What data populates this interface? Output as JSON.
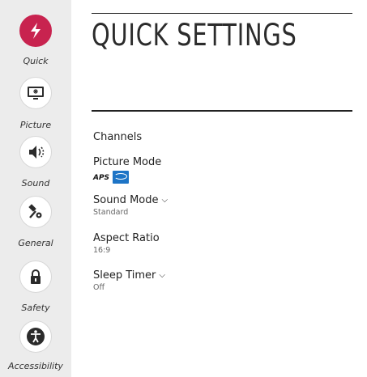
{
  "sidebar": {
    "items": [
      {
        "label": "Quick",
        "icon": "lightning-icon"
      },
      {
        "label": "Picture",
        "icon": "picture-icon"
      },
      {
        "label": "Sound",
        "icon": "speaker-icon"
      },
      {
        "label": "General",
        "icon": "tools-icon"
      },
      {
        "label": "Safety",
        "icon": "lock-icon"
      },
      {
        "label": "Accessibility",
        "icon": "accessibility-icon"
      }
    ],
    "active": "Quick"
  },
  "main": {
    "title": "QUICK SETTINGS",
    "items": [
      {
        "label": "Channels"
      },
      {
        "label": "Picture Mode",
        "logo_text": "APS"
      },
      {
        "label": "Sound Mode",
        "value": "Standard"
      },
      {
        "label": "Aspect Ratio",
        "value": "16:9"
      },
      {
        "label": "Sleep Timer",
        "value": "Off"
      }
    ]
  },
  "colors": {
    "accent": "#c8234f",
    "sidebar_bg": "#ececec",
    "energy_star": "#1d74c6"
  }
}
